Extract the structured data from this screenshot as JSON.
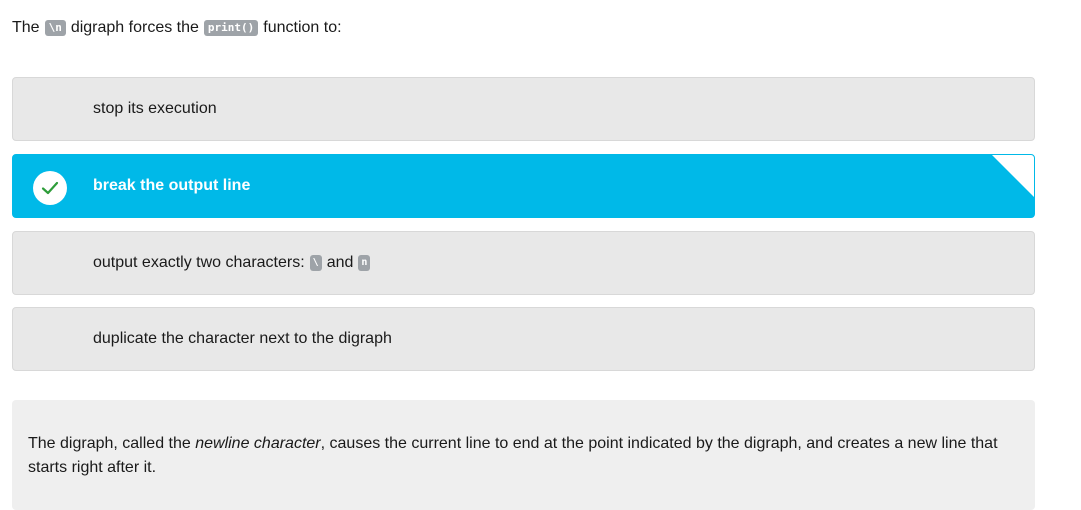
{
  "question": {
    "prefix": "The",
    "code1": "\\n",
    "middle": "digraph forces the",
    "code2": "print()",
    "suffix": "function to:"
  },
  "options": [
    {
      "label": "stop its execution",
      "selected": false
    },
    {
      "label": "break the output line",
      "selected": true
    },
    {
      "label_prefix": "output exactly two characters:",
      "code_a": "\\",
      "and": "and",
      "code_b": "n",
      "selected": false
    },
    {
      "label": "duplicate the character next to the digraph",
      "selected": false
    }
  ],
  "feedback": {
    "part1": "The digraph, called the ",
    "emphasis": "newline character",
    "part2": ", causes the current line to end at the point indicated by the digraph, and creates a new line that starts right after it."
  },
  "colors": {
    "correct": "#00b9e8",
    "check": "#2e9d3a",
    "option_bg": "#e8e8e8",
    "code_bg": "#9ea3a8"
  },
  "icons": {
    "correct_marker": "checkmark-icon"
  }
}
